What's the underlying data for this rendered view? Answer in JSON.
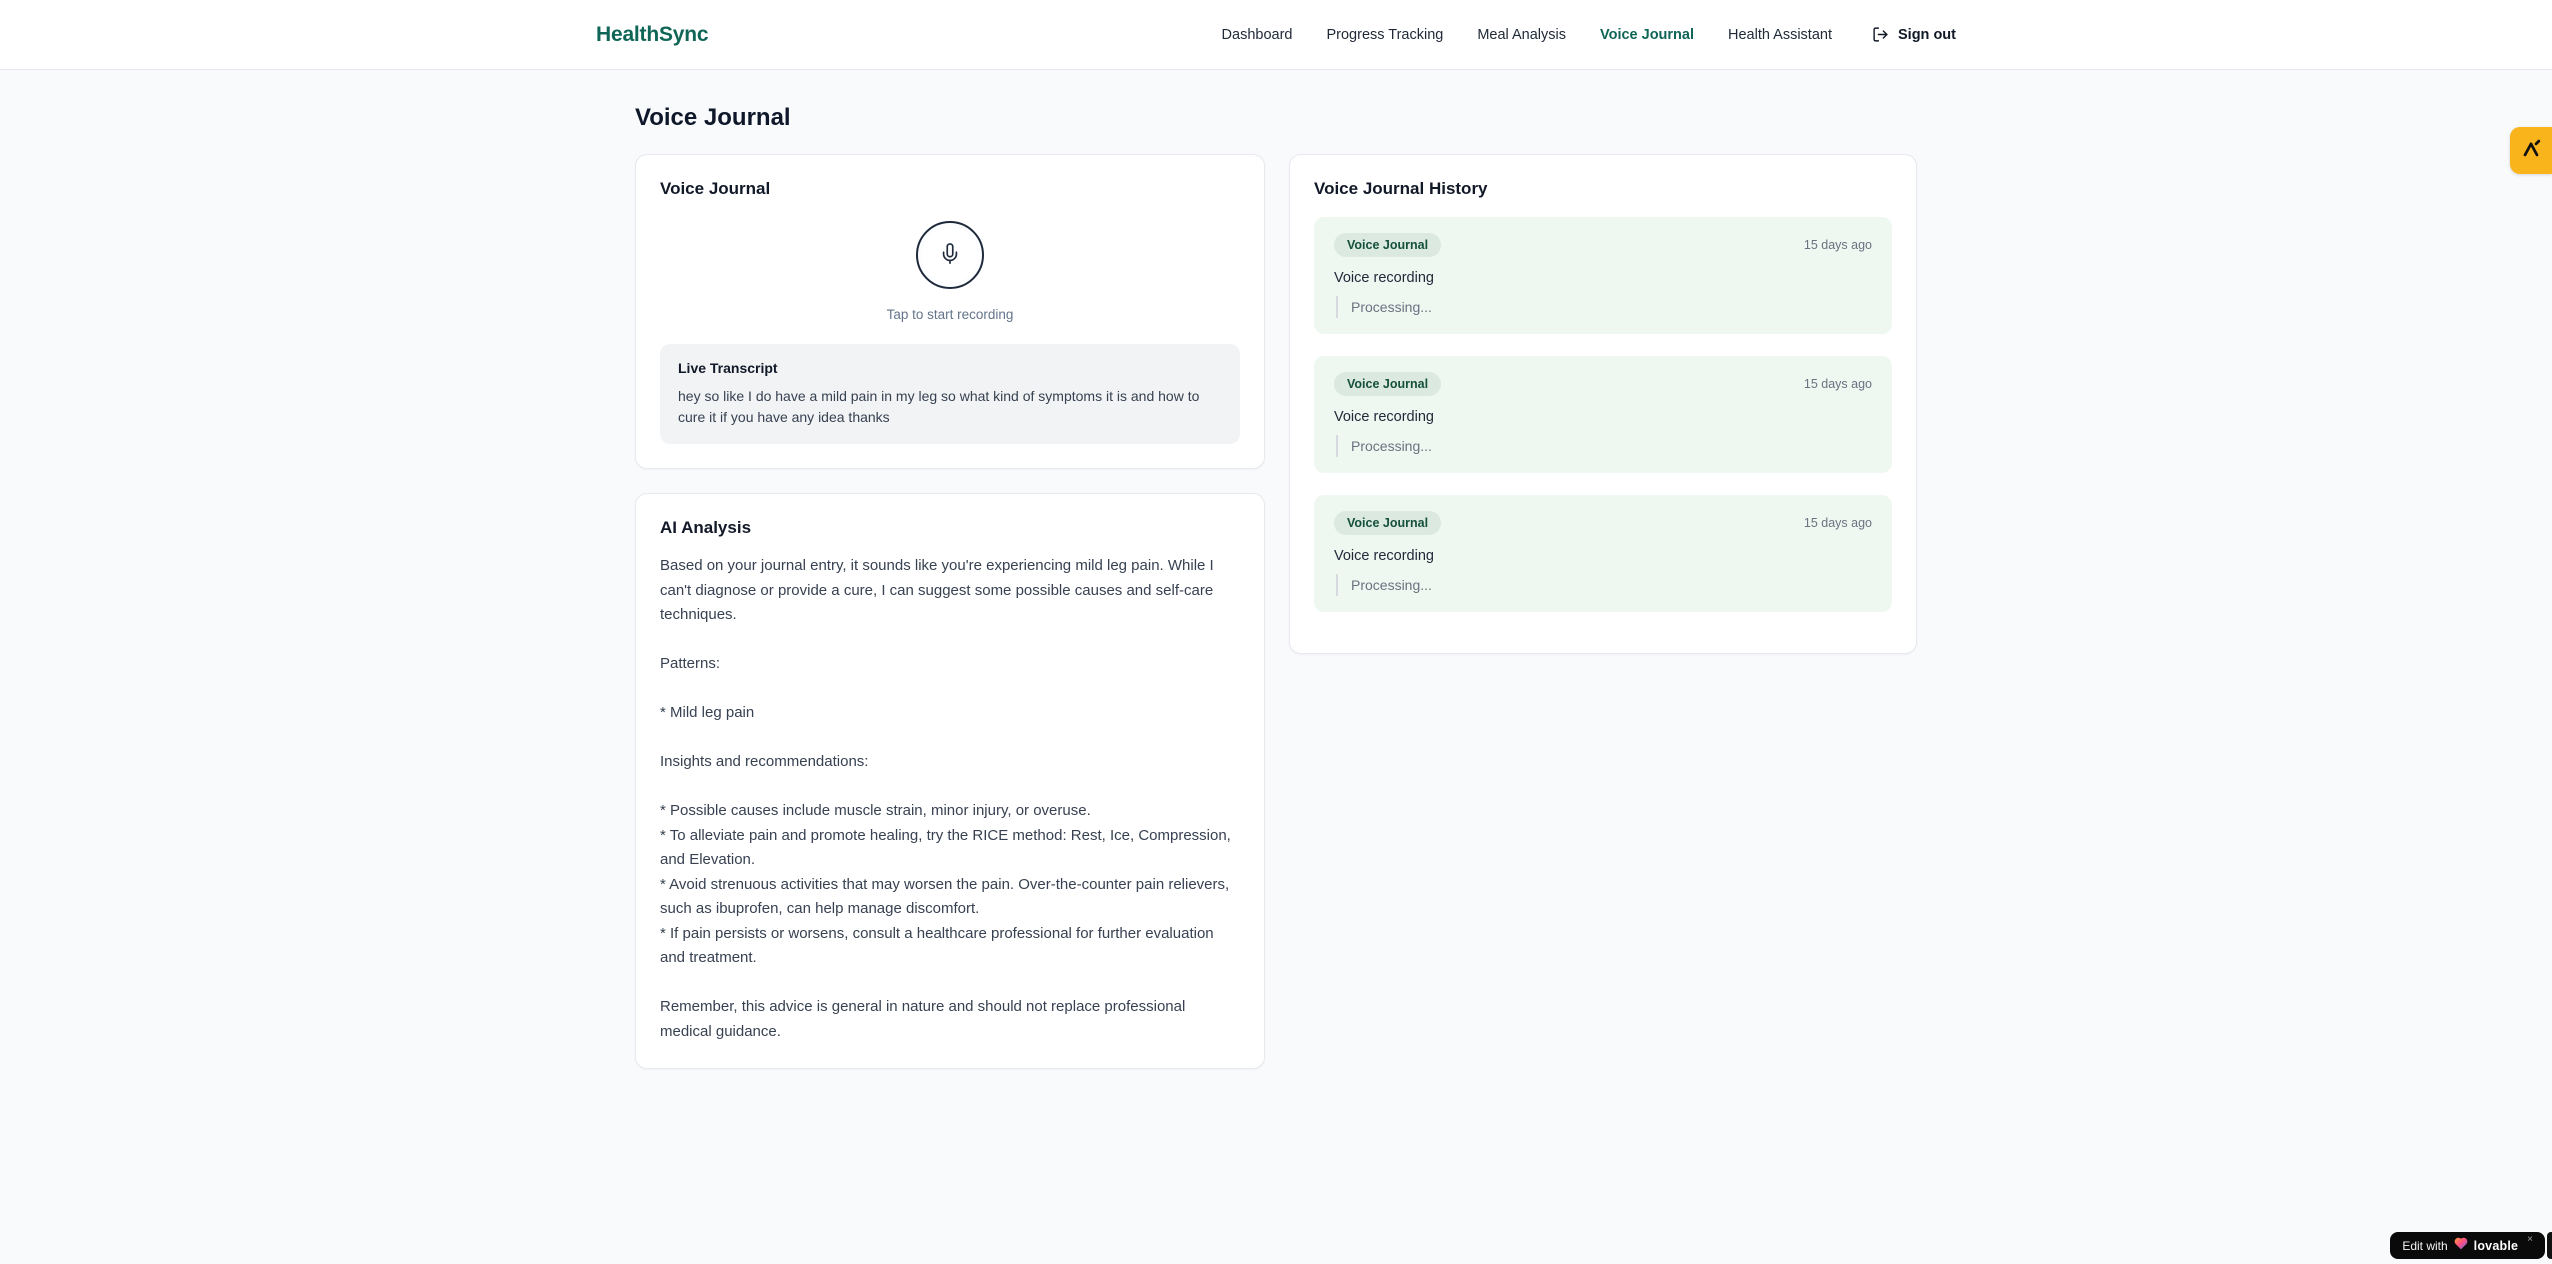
{
  "brand": {
    "name": "HealthSync"
  },
  "nav": {
    "items": [
      {
        "label": "Dashboard",
        "active": false
      },
      {
        "label": "Progress Tracking",
        "active": false
      },
      {
        "label": "Meal Analysis",
        "active": false
      },
      {
        "label": "Voice Journal",
        "active": true
      },
      {
        "label": "Health Assistant",
        "active": false
      }
    ],
    "sign_out_label": "Sign out"
  },
  "page": {
    "title": "Voice Journal"
  },
  "recorder_card": {
    "title": "Voice Journal",
    "tap_hint": "Tap to start recording",
    "transcript": {
      "title": "Live Transcript",
      "text": "hey so like I do have a mild pain in my leg so what kind of symptoms it is and how to cure it if you have any idea thanks"
    }
  },
  "analysis_card": {
    "title": "AI Analysis",
    "body": "Based on your journal entry, it sounds like you're experiencing mild leg pain. While I can't diagnose or provide a cure, I can suggest some possible causes and self-care techniques.\n\nPatterns:\n\n* Mild leg pain\n\nInsights and recommendations:\n\n* Possible causes include muscle strain, minor injury, or overuse.\n* To alleviate pain and promote healing, try the RICE method: Rest, Ice, Compression, and Elevation.\n* Avoid strenuous activities that may worsen the pain. Over-the-counter pain relievers, such as ibuprofen, can help manage discomfort.\n* If pain persists or worsens, consult a healthcare professional for further evaluation and treatment.\n\nRemember, this advice is general in nature and should not replace professional medical guidance."
  },
  "history_card": {
    "title": "Voice Journal History",
    "entries": [
      {
        "badge": "Voice Journal",
        "time": "15 days ago",
        "label": "Voice recording",
        "status": "Processing..."
      },
      {
        "badge": "Voice Journal",
        "time": "15 days ago",
        "label": "Voice recording",
        "status": "Processing..."
      },
      {
        "badge": "Voice Journal",
        "time": "15 days ago",
        "label": "Voice recording",
        "status": "Processing..."
      }
    ]
  },
  "lovable": {
    "edit_label": "Edit with",
    "brand_label": "lovable",
    "close_label": "×"
  },
  "colors": {
    "brand_green": "#0f6657",
    "history_entry_bg": "#eff7f1",
    "badge_bg": "#dbe9e1",
    "badge_text": "#15503c",
    "lovable_yellow": "#f9b41c",
    "lovable_badge_bg": "#0a0a0a",
    "page_bg": "#f8fafc",
    "muted_text": "#6b7280"
  }
}
